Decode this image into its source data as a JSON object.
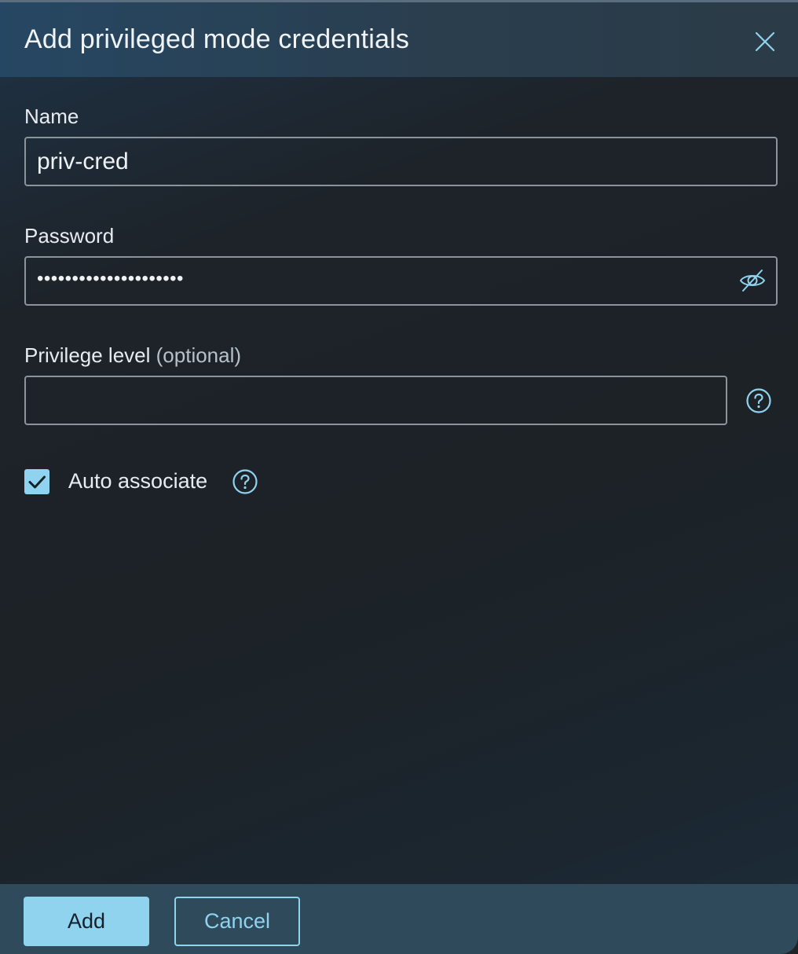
{
  "dialog": {
    "title": "Add privileged mode credentials"
  },
  "form": {
    "name": {
      "label": "Name",
      "value": "priv-cred"
    },
    "password": {
      "label": "Password",
      "masked_value": "•••••••••••••••••••••"
    },
    "privilege_level": {
      "label": "Privilege level",
      "optional_note": "(optional)",
      "value": ""
    },
    "auto_associate": {
      "label": "Auto associate",
      "checked": true
    }
  },
  "footer": {
    "add_label": "Add",
    "cancel_label": "Cancel"
  },
  "colors": {
    "accent": "#8fd3ef",
    "header_bg": "#264763",
    "footer_bg": "#2f4a5a"
  },
  "icons": {
    "close": "close-icon",
    "password_toggle": "eye-slash-icon",
    "help": "help-circle-icon",
    "check": "checkmark-icon"
  }
}
